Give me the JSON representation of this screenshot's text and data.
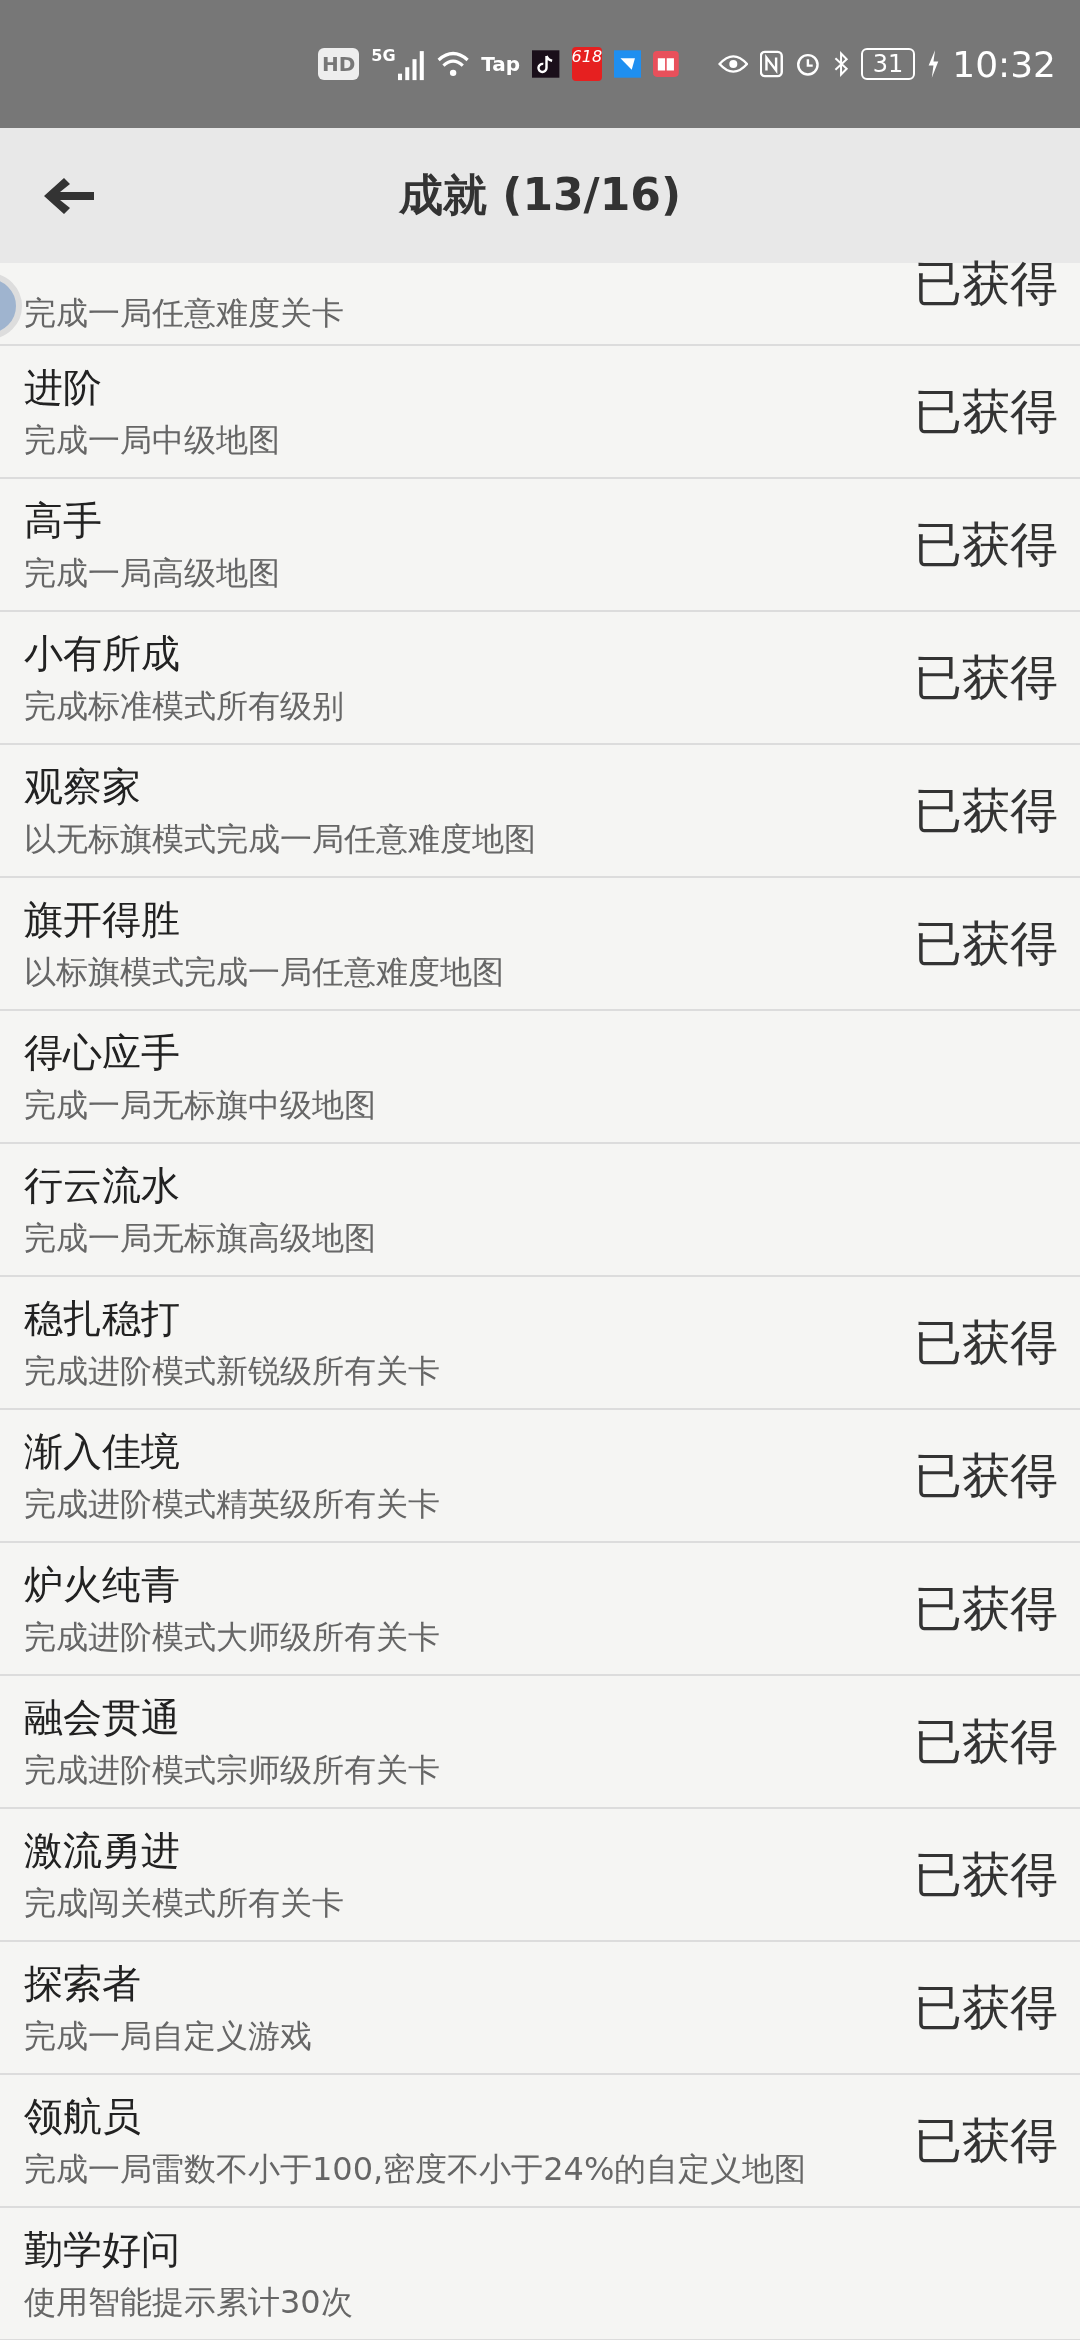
{
  "status_bar": {
    "hd": "HD",
    "network": "5G",
    "tap": "Tap",
    "promo": "618",
    "battery": "31",
    "time": "10:32"
  },
  "header": {
    "title": "成就 (13/16)"
  },
  "partial_row": {
    "description": "完成一局任意难度关卡",
    "status": "已获得"
  },
  "achievements": [
    {
      "title": "进阶",
      "description": "完成一局中级地图",
      "status": "已获得"
    },
    {
      "title": "高手",
      "description": "完成一局高级地图",
      "status": "已获得"
    },
    {
      "title": "小有所成",
      "description": "完成标准模式所有级别",
      "status": "已获得"
    },
    {
      "title": "观察家",
      "description": "以无标旗模式完成一局任意难度地图",
      "status": "已获得"
    },
    {
      "title": "旗开得胜",
      "description": "以标旗模式完成一局任意难度地图",
      "status": "已获得"
    },
    {
      "title": "得心应手",
      "description": "完成一局无标旗中级地图"
    },
    {
      "title": "行云流水",
      "description": "完成一局无标旗高级地图"
    },
    {
      "title": "稳扎稳打",
      "description": "完成进阶模式新锐级所有关卡",
      "status": "已获得"
    },
    {
      "title": "渐入佳境",
      "description": "完成进阶模式精英级所有关卡",
      "status": "已获得"
    },
    {
      "title": "炉火纯青",
      "description": "完成进阶模式大师级所有关卡",
      "status": "已获得"
    },
    {
      "title": "融会贯通",
      "description": "完成进阶模式宗师级所有关卡",
      "status": "已获得"
    },
    {
      "title": "激流勇进",
      "description": "完成闯关模式所有关卡",
      "status": "已获得"
    },
    {
      "title": "探索者",
      "description": "完成一局自定义游戏",
      "status": "已获得"
    },
    {
      "title": "领航员",
      "description": "完成一局雷数不小于100,密度不小于24%的自定义地图",
      "status": "已获得"
    },
    {
      "title": "勤学好问",
      "description": "使用智能提示累计30次"
    }
  ]
}
